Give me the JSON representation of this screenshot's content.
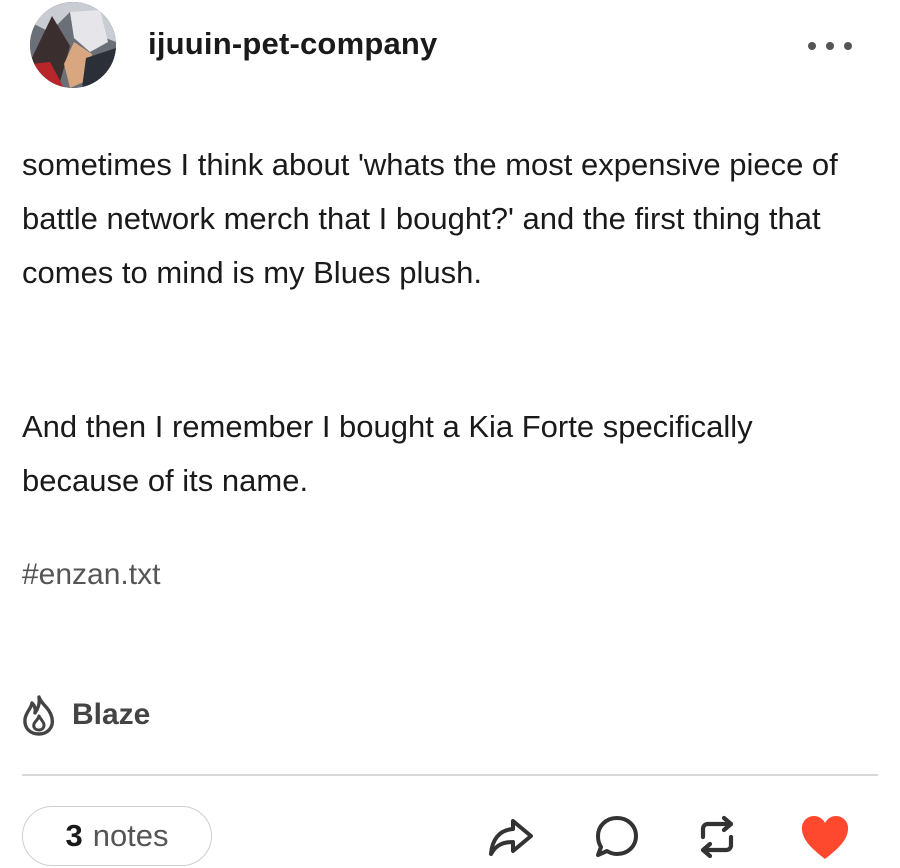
{
  "post": {
    "username": "ijuuin-pet-company",
    "paragraphs": [
      "sometimes I think about 'whats the most expensive piece of battle network merch that I bought?' and the first thing that comes to mind is my Blues plush.",
      "And then I remember I bought a Kia Forte specifically because of its name."
    ],
    "tag": "#enzan.txt"
  },
  "blaze": {
    "label": "Blaze"
  },
  "footer": {
    "notes_count": "3",
    "notes_label": "notes"
  },
  "icons": {
    "avatar": "avatar-image",
    "more": "ellipsis-icon",
    "blaze": "flame-icon",
    "share": "share-arrow-icon",
    "reply": "speech-bubble-icon",
    "reblog": "reblog-icon",
    "like": "heart-icon"
  },
  "colors": {
    "like": "#ff492f",
    "icon": "#333333",
    "muted": "#555555"
  }
}
